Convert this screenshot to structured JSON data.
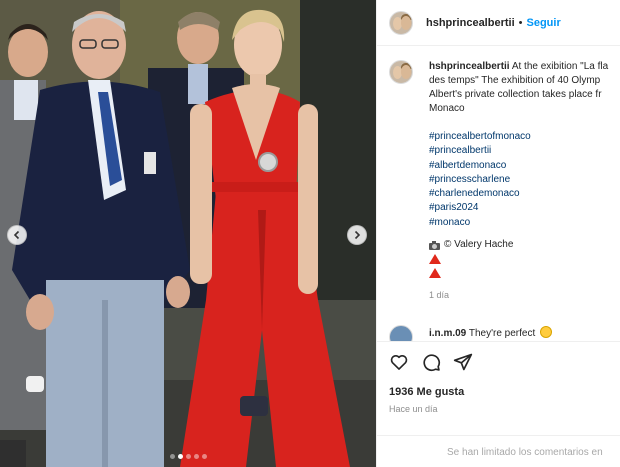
{
  "post": {
    "username": "hshprincealbertii",
    "follow_label": "Seguir",
    "separator": "•"
  },
  "caption": {
    "username": "hshprincealbertii",
    "line1": "At the exibition \"La fla",
    "line2": "des temps\" The exhibition of 40 Olymp",
    "line3": "Albert's private collection takes place fr",
    "line4": "Monaco",
    "hashtags": [
      "#princealbertofmonaco",
      "#princealbertii",
      "#albertdemonaco",
      "#princesscharlene",
      "#charlenedemonaco",
      "#paris2024",
      "#monaco"
    ],
    "credit": "© Valery Hache",
    "time": "1 día"
  },
  "comment": {
    "username": "i.n.m.09",
    "text": "They're perfect"
  },
  "actions": {
    "likes": "1936 Me gusta",
    "time_ago": "Hace un día"
  },
  "footer": {
    "text": "Se han limitado los comentarios en"
  },
  "carousel": {
    "dot_count": 5,
    "active_index": 1
  },
  "icons": {
    "prev": "chevron-left-icon",
    "next": "chevron-right-icon",
    "like": "heart-icon",
    "comment": "comment-bubble-icon",
    "share": "paper-plane-icon",
    "camera": "camera-icon",
    "warning": "red-triangle-icon",
    "emoji": "smiling-face-icon"
  },
  "colors": {
    "accent": "#0095f6",
    "hashtag": "#00376b",
    "dress": "#d8231e",
    "muted": "#8e8e8e"
  }
}
